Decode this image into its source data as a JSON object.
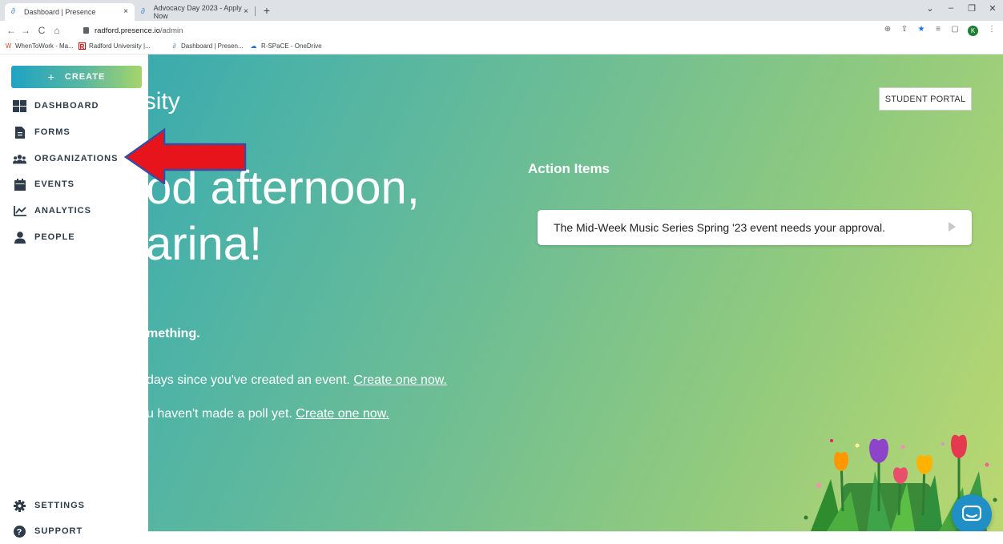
{
  "browser": {
    "tabs": [
      {
        "title": "Dashboard | Presence",
        "close": "×",
        "active": true
      },
      {
        "title": "Advocacy Day 2023 - Apply Now",
        "close": "×",
        "active": false
      }
    ],
    "new_tab": "+",
    "window_controls": {
      "dropdown": "⌄",
      "minimize": "–",
      "restore": "❐",
      "close": "✕"
    },
    "nav": {
      "back": "←",
      "forward": "→",
      "reload": "C",
      "home": "⌂"
    },
    "url_host": "radford.presence.io",
    "url_path": "/admin",
    "toolbar_icons": {
      "zoom": "⊕",
      "share": "⇪",
      "star": "★",
      "reading_list": "≡",
      "side_panel": "▢",
      "menu": "⋮"
    },
    "profile_initial": "K",
    "bookmarks": [
      {
        "label": "WhenToWork - Ma...",
        "icon": "W"
      },
      {
        "label": "Radford University |...",
        "icon": "R"
      },
      {
        "label": "Dashboard | Presen...",
        "icon": "∂"
      },
      {
        "label": "R-SPaCE - OneDrive",
        "icon": "☁"
      }
    ]
  },
  "sidebar": {
    "create_icon": "+",
    "create_label": "CREATE",
    "items": [
      {
        "label": "DASHBOARD",
        "icon": "dashboard-icon"
      },
      {
        "label": "FORMS",
        "icon": "document-icon"
      },
      {
        "label": "ORGANIZATIONS",
        "icon": "users-icon"
      },
      {
        "label": "EVENTS",
        "icon": "calendar-icon"
      },
      {
        "label": "ANALYTICS",
        "icon": "chart-icon"
      },
      {
        "label": "PEOPLE",
        "icon": "person-icon"
      }
    ],
    "bottom_items": [
      {
        "label": "SETTINGS",
        "icon": "gear-icon"
      },
      {
        "label": "SUPPORT",
        "icon": "help-icon"
      }
    ]
  },
  "main": {
    "university_title": "d University",
    "greeting_line1": "od afternoon,",
    "greeting_line2": "arina!",
    "sub_heading": "mething.",
    "prompt_event_text": "days since you've created an event. ",
    "prompt_event_link": "Create one now.",
    "prompt_poll_text": "u haven't made a poll yet. ",
    "prompt_poll_link": "Create one now.",
    "student_portal": "STUDENT PORTAL",
    "action_items_title": "Action Items",
    "action_item_text": "The Mid-Week Music Series Spring '23 event needs your approval."
  },
  "colors": {
    "gradient_start": "#2aa3b5",
    "gradient_end": "#bbd870",
    "arrow": "#e8141c",
    "arrow_outline": "#3a4aa0",
    "chat": "#1f8fc6",
    "sidebar_text": "#2d3b4a"
  }
}
